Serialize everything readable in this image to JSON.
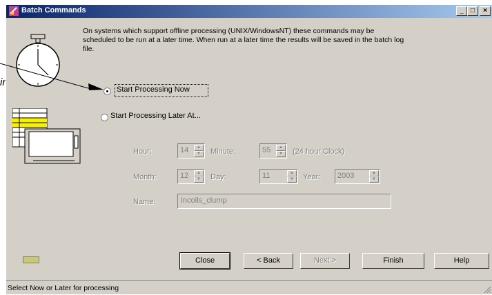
{
  "callout": {
    "text": "in"
  },
  "window": {
    "title": "Batch Commands",
    "controls": [
      "_",
      "□",
      "×"
    ]
  },
  "description": "On systems which support offline processing (UNIX/WindowsNT) these commands may be scheduled to be run at a later time. When run at a later time the results will be saved in the batch log file.",
  "options": {
    "now_label": "Start Processing Now",
    "later_label": "Start Processing Later At...",
    "selected": "now"
  },
  "schedule": {
    "hour_label": "Hour:",
    "hour_value": "14",
    "minute_label": "Minute:",
    "minute_value": "55",
    "clock_note": "(24 hour Clock)",
    "month_label": "Month:",
    "month_value": "12",
    "day_label": "Day:",
    "day_value": "11",
    "year_label": "Year:",
    "year_value": "2003",
    "name_label": "Name:",
    "name_value": "Incoils_clump"
  },
  "buttons": {
    "close": "Close",
    "back": "< Back",
    "next": "Next >",
    "finish": "Finish",
    "help": "Help"
  },
  "status_bar": "Select Now or Later for processing",
  "icons": [
    "batch-app-icon",
    "stopwatch-icon",
    "spreadsheet-icon",
    "indicator-light-icon"
  ]
}
